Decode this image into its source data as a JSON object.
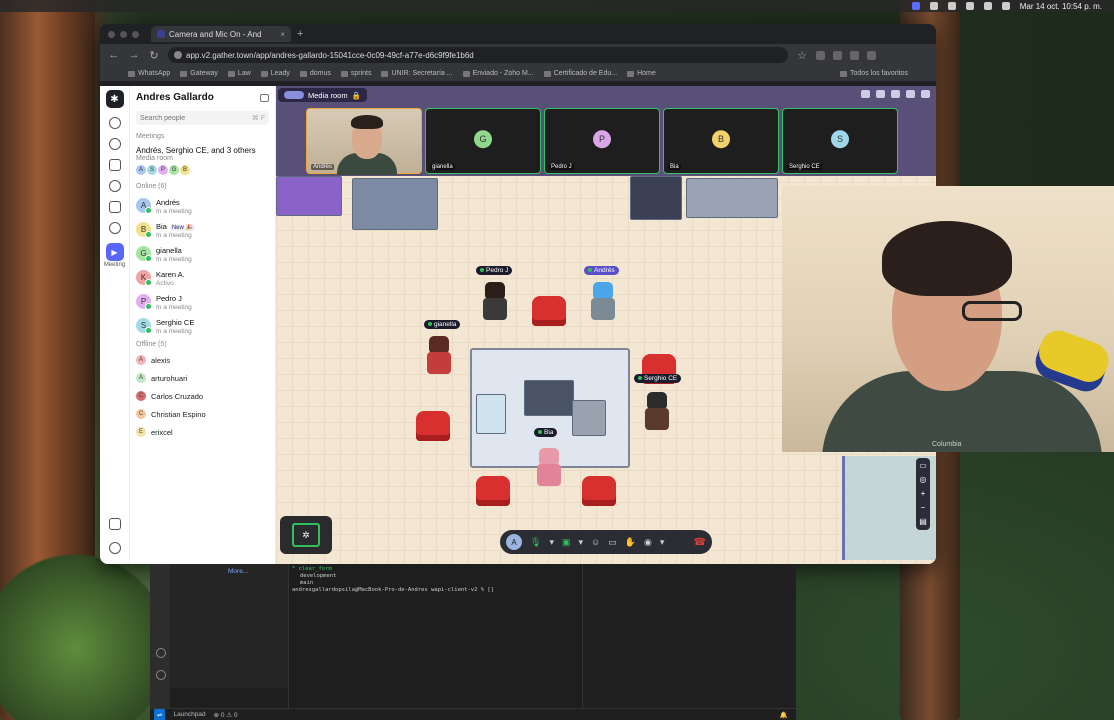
{
  "menubar": {
    "clock": "Mar 14 oct. 10:54 p. m."
  },
  "browser": {
    "tab_title": "Camera and Mic On - And",
    "url": "app.v2.gather.town/app/andres-gallardo-15041cce-0c09-49cf-a77e-d6c9f9fe1b6d",
    "bookmarks": [
      "WhatsApp",
      "Gateway",
      "Law",
      "Leady",
      "domus",
      "sprints",
      "UNIR: Secretaría ...",
      "Enviado - Zoho M...",
      "Certificado de Edu...",
      "Home"
    ],
    "other_bookmarks": "Todos los favoritos"
  },
  "sidebar": {
    "title": "Andres Gallardo",
    "search_placeholder": "Search people",
    "search_shortcut": "⌘ F",
    "meetings_label": "Meetings",
    "meeting": {
      "title": "Andrés, Serghio CE, and 3 others",
      "subtitle": "Media room",
      "avatars": [
        "A",
        "S",
        "P",
        "G",
        "B"
      ]
    },
    "online_label": "Online (6)",
    "online": [
      {
        "initial": "A",
        "name": "Andrés",
        "status": "In a meeting",
        "color": "#a9c7ee",
        "badge": ""
      },
      {
        "initial": "B",
        "name": "Bia",
        "status": "In a meeting",
        "color": "#f3e08a",
        "badge": "New 🎉"
      },
      {
        "initial": "G",
        "name": "gianella",
        "status": "In a meeting",
        "color": "#a7e3a2",
        "badge": ""
      },
      {
        "initial": "K",
        "name": "Karen A.",
        "status": "Activo",
        "color": "#f2a2a2",
        "badge": ""
      },
      {
        "initial": "P",
        "name": "Pedro J",
        "status": "In a meeting",
        "color": "#e2b0ee",
        "badge": ""
      },
      {
        "initial": "S",
        "name": "Serghio CE",
        "status": "In a meeting",
        "color": "#a3dbe8",
        "badge": ""
      }
    ],
    "offline_label": "Offline (5)",
    "offline": [
      {
        "initial": "A",
        "name": "alexis",
        "color": "#f4b2b2"
      },
      {
        "initial": "A",
        "name": "arturohuari",
        "color": "#bfe6c0"
      },
      {
        "initial": "C",
        "name": "Carlos Cruzado",
        "color": "#d86a6a"
      },
      {
        "initial": "C",
        "name": "Christian Espino",
        "color": "#f4c79d"
      },
      {
        "initial": "E",
        "name": "erixcel",
        "color": "#f6e2a0"
      }
    ],
    "rail_meeting_label": "Meeting"
  },
  "room": {
    "name": "Media room",
    "tiles": [
      {
        "initial": "",
        "label": "Andrés",
        "color": ""
      },
      {
        "initial": "G",
        "label": "gianella",
        "color": "#8fd98d"
      },
      {
        "initial": "P",
        "label": "Pedro J",
        "color": "#d9a6e8"
      },
      {
        "initial": "B",
        "label": "Bia",
        "color": "#f0d36a"
      },
      {
        "initial": "S",
        "label": "Serghio CE",
        "color": "#a0d8ea"
      }
    ],
    "nametags": {
      "pedro": "Pedro J",
      "andres": "Andrés",
      "gianella": "gianella",
      "serghio": "Serghio CE",
      "bia": "Bia"
    }
  },
  "controls": {
    "me_initial": "A"
  },
  "webcam": {
    "shirt_text": "Columbia"
  },
  "editor": {
    "more_link": "More...",
    "terminal_lines": [
      "* clear_form",
      "development",
      "main",
      "andresgallardopsila@MacBook-Pro-de-Andres wapi-client-v2 % []"
    ],
    "status_launchpad": "Launchpad",
    "status_problems": "⊗ 0 ⚠ 0"
  }
}
